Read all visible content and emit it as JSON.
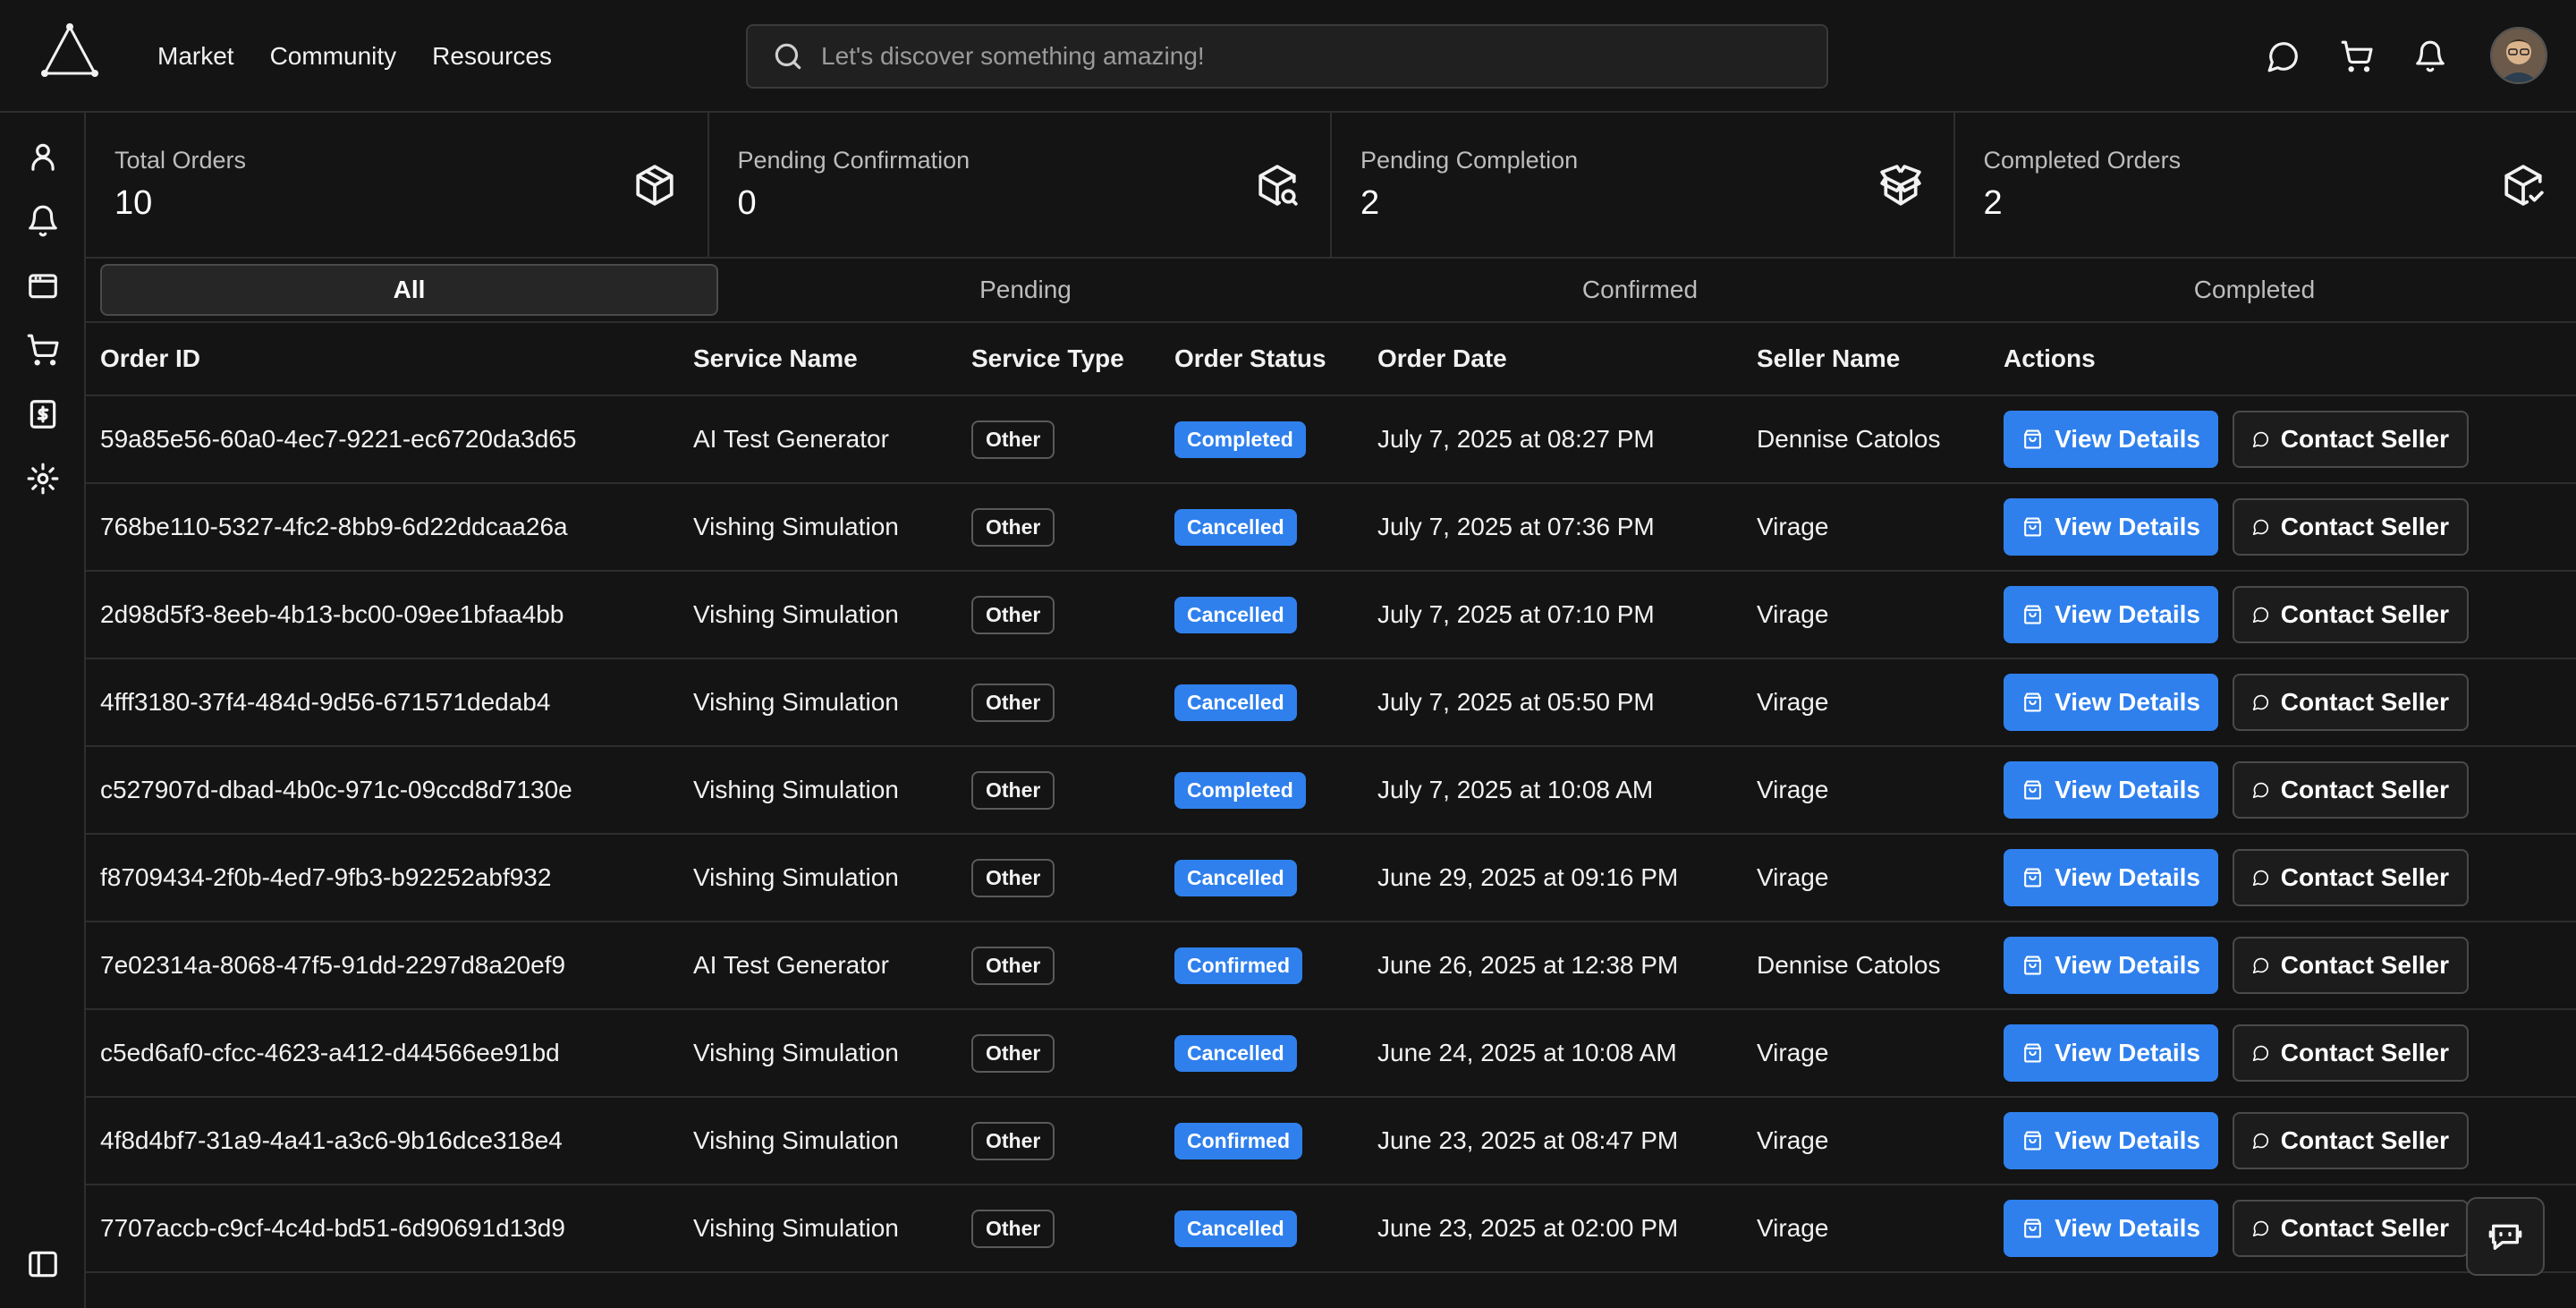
{
  "nav": {
    "links": [
      "Market",
      "Community",
      "Resources"
    ],
    "search_placeholder": "Let's discover something amazing!"
  },
  "top_icons": [
    "chat-bubble-icon",
    "cart-icon",
    "bell-icon"
  ],
  "sidebar": {
    "icons": [
      "user-icon",
      "bell-icon",
      "browser-icon",
      "cart-icon",
      "dollar-document-icon",
      "gear-icon",
      "panel-toggle-icon"
    ]
  },
  "stats": [
    {
      "label": "Total Orders",
      "value": "10",
      "icon": "package-icon"
    },
    {
      "label": "Pending Confirmation",
      "value": "0",
      "icon": "package-search-icon"
    },
    {
      "label": "Pending Completion",
      "value": "2",
      "icon": "package-open-icon"
    },
    {
      "label": "Completed Orders",
      "value": "2",
      "icon": "package-check-icon"
    }
  ],
  "tabs": [
    "All",
    "Pending",
    "Confirmed",
    "Completed"
  ],
  "active_tab": "All",
  "table": {
    "headers": [
      "Order ID",
      "Service Name",
      "Service Type",
      "Order Status",
      "Order Date",
      "Seller Name",
      "Actions"
    ],
    "view_label": "View Details",
    "contact_label": "Contact Seller",
    "rows": [
      {
        "id": "59a85e56-60a0-4ec7-9221-ec6720da3d65",
        "service": "AI Test Generator",
        "type": "Other",
        "status": "Completed",
        "date": "July 7, 2025 at 08:27 PM",
        "seller": "Dennise Catolos"
      },
      {
        "id": "768be110-5327-4fc2-8bb9-6d22ddcaa26a",
        "service": "Vishing Simulation",
        "type": "Other",
        "status": "Cancelled",
        "date": "July 7, 2025 at 07:36 PM",
        "seller": "Virage"
      },
      {
        "id": "2d98d5f3-8eeb-4b13-bc00-09ee1bfaa4bb",
        "service": "Vishing Simulation",
        "type": "Other",
        "status": "Cancelled",
        "date": "July 7, 2025 at 07:10 PM",
        "seller": "Virage"
      },
      {
        "id": "4fff3180-37f4-484d-9d56-671571dedab4",
        "service": "Vishing Simulation",
        "type": "Other",
        "status": "Cancelled",
        "date": "July 7, 2025 at 05:50 PM",
        "seller": "Virage"
      },
      {
        "id": "c527907d-dbad-4b0c-971c-09ccd8d7130e",
        "service": "Vishing Simulation",
        "type": "Other",
        "status": "Completed",
        "date": "July 7, 2025 at 10:08 AM",
        "seller": "Virage"
      },
      {
        "id": "f8709434-2f0b-4ed7-9fb3-b92252abf932",
        "service": "Vishing Simulation",
        "type": "Other",
        "status": "Cancelled",
        "date": "June 29, 2025 at 09:16 PM",
        "seller": "Virage"
      },
      {
        "id": "7e02314a-8068-47f5-91dd-2297d8a20ef9",
        "service": "AI Test Generator",
        "type": "Other",
        "status": "Confirmed",
        "date": "June 26, 2025 at 12:38 PM",
        "seller": "Dennise Catolos"
      },
      {
        "id": "c5ed6af0-cfcc-4623-a412-d44566ee91bd",
        "service": "Vishing Simulation",
        "type": "Other",
        "status": "Cancelled",
        "date": "June 24, 2025 at 10:08 AM",
        "seller": "Virage"
      },
      {
        "id": "4f8d4bf7-31a9-4a41-a3c6-9b16dce318e4",
        "service": "Vishing Simulation",
        "type": "Other",
        "status": "Confirmed",
        "date": "June 23, 2025 at 08:47 PM",
        "seller": "Virage"
      },
      {
        "id": "7707accb-c9cf-4c4d-bd51-6d90691d13d9",
        "service": "Vishing Simulation",
        "type": "Other",
        "status": "Cancelled",
        "date": "June 23, 2025 at 02:00 PM",
        "seller": "Virage"
      }
    ]
  },
  "colors": {
    "background": "#141414",
    "accent": "#2f80ed",
    "border": "#2e2e2e"
  }
}
